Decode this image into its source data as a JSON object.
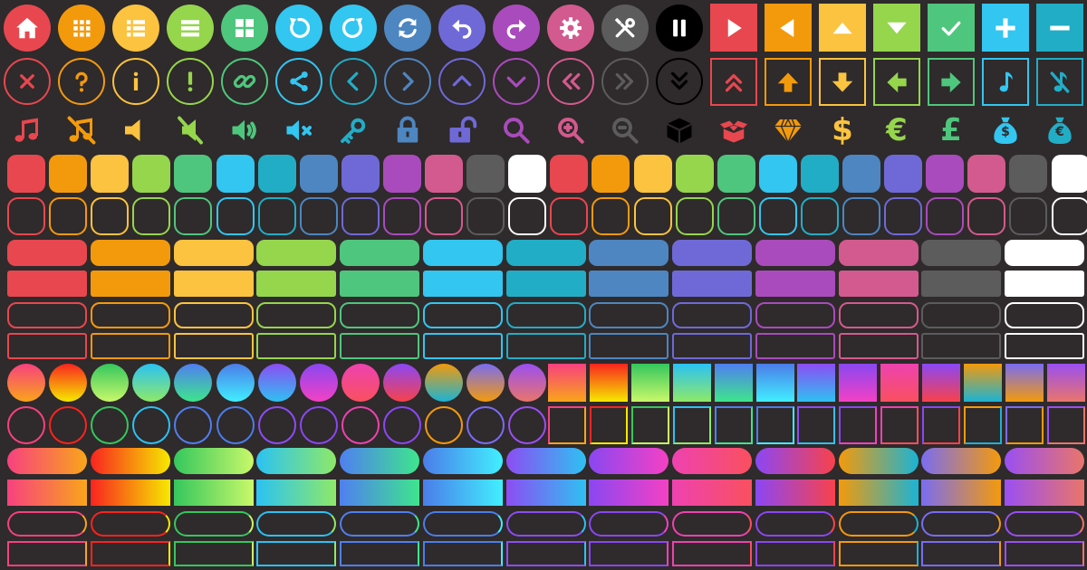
{
  "sheet": {
    "background": "#2f2a2b",
    "palette": {
      "red": "#e8474f",
      "orange": "#f39a0c",
      "yellow": "#fbc33f",
      "lime": "#95d64d",
      "green": "#4fc67d",
      "sky": "#32c6f1",
      "teal": "#22adc6",
      "steel": "#4d86c1",
      "indigo": "#6f69d8",
      "purple": "#a94bbd",
      "pink": "#d35a8e",
      "gray": "#5c5c5c",
      "white": "#ffffff"
    },
    "row1_circle_buttons": [
      {
        "icon": "home-icon",
        "color": "#e8474f"
      },
      {
        "icon": "grid-icon",
        "color": "#f39a0c"
      },
      {
        "icon": "list-icon",
        "color": "#fbc33f"
      },
      {
        "icon": "menu-icon",
        "color": "#95d64d"
      },
      {
        "icon": "tiles-icon",
        "color": "#4fc67d"
      },
      {
        "icon": "rotate-ccw-icon",
        "color": "#32c6f1"
      },
      {
        "icon": "rotate-cw-icon",
        "color": "#32c6f1"
      },
      {
        "icon": "sync-icon",
        "color": "#4d86c1"
      },
      {
        "icon": "undo-icon",
        "color": "#6f69d8"
      },
      {
        "icon": "redo-icon",
        "color": "#a94bbd"
      },
      {
        "icon": "gear-icon",
        "color": "#d35a8e"
      },
      {
        "icon": "tools-icon",
        "color": "#5c5c5c"
      },
      {
        "icon": "pause-icon",
        "color": "#000000"
      }
    ],
    "row1_square_buttons": [
      {
        "icon": "play-icon",
        "color": "#e8474f"
      },
      {
        "icon": "back-icon",
        "color": "#f39a0c"
      },
      {
        "icon": "up-icon",
        "color": "#fbc33f"
      },
      {
        "icon": "down-icon",
        "color": "#95d64d"
      },
      {
        "icon": "check-icon",
        "color": "#4fc67d"
      },
      {
        "icon": "plus-icon",
        "color": "#32c6f1"
      },
      {
        "icon": "minus-icon",
        "color": "#22adc6"
      }
    ],
    "row2_circle_outline_buttons": [
      {
        "icon": "close-icon",
        "color": "#e8474f"
      },
      {
        "icon": "question-icon",
        "color": "#f39a0c"
      },
      {
        "icon": "info-icon",
        "color": "#fbc33f"
      },
      {
        "icon": "exclamation-icon",
        "color": "#95d64d"
      },
      {
        "icon": "link-icon",
        "color": "#4fc67d"
      },
      {
        "icon": "share-icon",
        "color": "#32c6f1"
      },
      {
        "icon": "chevron-left-icon",
        "color": "#22adc6"
      },
      {
        "icon": "chevron-right-icon",
        "color": "#4d86c1"
      },
      {
        "icon": "chevron-up-icon",
        "color": "#6f69d8"
      },
      {
        "icon": "chevron-down-icon",
        "color": "#a94bbd"
      },
      {
        "icon": "double-chevron-left-icon",
        "color": "#d35a8e"
      },
      {
        "icon": "double-chevron-right-icon",
        "color": "#5c5c5c"
      },
      {
        "icon": "double-chevron-down-icon",
        "color": "#000000"
      }
    ],
    "row2_square_outline_buttons": [
      {
        "icon": "double-chevron-up-icon",
        "color": "#e8474f"
      },
      {
        "icon": "arrow-up-icon",
        "color": "#f39a0c"
      },
      {
        "icon": "arrow-down-icon",
        "color": "#fbc33f"
      },
      {
        "icon": "arrow-left-icon",
        "color": "#95d64d"
      },
      {
        "icon": "arrow-right-icon",
        "color": "#4fc67d"
      },
      {
        "icon": "music-note-icon",
        "color": "#32c6f1"
      },
      {
        "icon": "music-note-muted-icon",
        "color": "#22adc6"
      }
    ],
    "row3_glyphs": [
      {
        "icon": "music-icon",
        "color": "#e8474f"
      },
      {
        "icon": "music-muted-icon",
        "color": "#f39a0c"
      },
      {
        "icon": "speaker-icon",
        "color": "#fbc33f"
      },
      {
        "icon": "speaker-muted-icon",
        "color": "#95d64d"
      },
      {
        "icon": "speaker-loud-icon",
        "color": "#4fc67d"
      },
      {
        "icon": "speaker-off-icon",
        "color": "#32c6f1"
      },
      {
        "icon": "key-icon",
        "color": "#22adc6"
      },
      {
        "icon": "lock-icon",
        "color": "#4d86c1"
      },
      {
        "icon": "unlock-icon",
        "color": "#6f69d8"
      },
      {
        "icon": "magnifier-icon",
        "color": "#a94bbd"
      },
      {
        "icon": "zoom-in-icon",
        "color": "#d35a8e"
      },
      {
        "icon": "zoom-out-icon",
        "color": "#5c5c5c"
      },
      {
        "icon": "cube-icon",
        "color": "#000000"
      },
      {
        "icon": "open-box-icon",
        "color": "#e8474f"
      },
      {
        "icon": "diamond-icon",
        "color": "#f39a0c"
      },
      {
        "icon": "dollar-icon",
        "color": "#fbc33f"
      },
      {
        "icon": "euro-icon",
        "color": "#95d64d"
      },
      {
        "icon": "pound-icon",
        "color": "#4fc67d"
      },
      {
        "icon": "money-bag-dollar-icon",
        "color": "#32c6f1"
      },
      {
        "icon": "money-bag-euro-icon",
        "color": "#22adc6"
      }
    ],
    "currency_symbols": [
      "$",
      "€",
      "£"
    ],
    "bag_symbols": [
      "$",
      "€"
    ],
    "zoom_symbols": [
      "+",
      "−"
    ],
    "square_colors": [
      "#e8474f",
      "#f39a0c",
      "#fbc33f",
      "#95d64d",
      "#4fc67d",
      "#32c6f1",
      "#22adc6",
      "#4d86c1",
      "#6f69d8",
      "#a94bbd",
      "#d35a8e",
      "#5c5c5c",
      "#ffffff"
    ],
    "wide_colors": [
      "#e8474f",
      "#f39a0c",
      "#fbc33f",
      "#95d64d",
      "#4fc67d",
      "#32c6f1",
      "#22adc6",
      "#4d86c1",
      "#6f69d8",
      "#a94bbd",
      "#d35a8e",
      "#5c5c5c",
      "#ffffff"
    ],
    "gradients": [
      [
        "#f7417f",
        "#f9a51a"
      ],
      [
        "#f9241f",
        "#f6e900"
      ],
      [
        "#34c75d",
        "#c9f86a"
      ],
      [
        "#2bc2f4",
        "#8ee968"
      ],
      [
        "#4f7ff0",
        "#3ee58d"
      ],
      [
        "#4b7de9",
        "#41efff"
      ],
      [
        "#8c4df3",
        "#2fc1f2"
      ],
      [
        "#8a47f1",
        "#f441c4"
      ],
      [
        "#ee42b0",
        "#f9505f"
      ],
      [
        "#8b47f5",
        "#f8424b"
      ],
      [
        "#f39a0c",
        "#1bb3d4"
      ],
      [
        "#7a6cf2",
        "#f39a0c"
      ],
      [
        "#9a4ff2",
        "#e9756a"
      ]
    ]
  }
}
